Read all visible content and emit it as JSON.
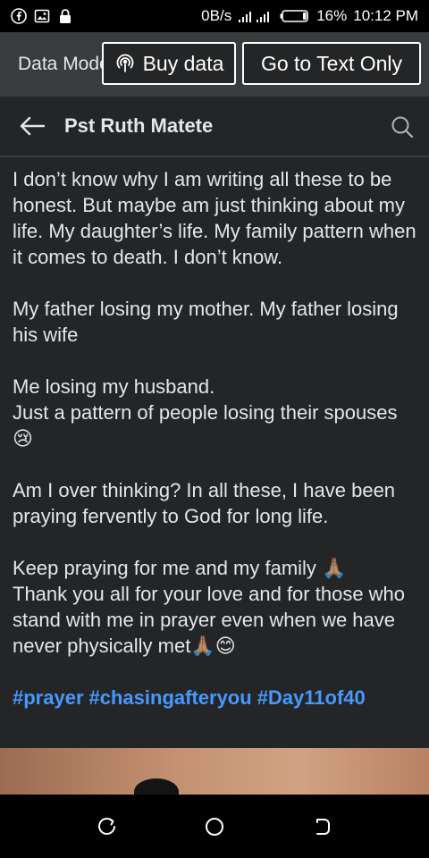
{
  "status_bar": {
    "net_speed": "0B/s",
    "battery": "16%",
    "time": "10:12 PM",
    "icons": [
      "facebook-icon",
      "image-icon",
      "lock-icon",
      "signal-icon",
      "battery-icon"
    ]
  },
  "data_bar": {
    "mode_label": "Data Mode",
    "buy_label": "Buy data",
    "text_only_label": "Go to Text Only"
  },
  "header": {
    "title": "Pst Ruth Matete"
  },
  "post": {
    "paragraphs": [
      "I don’t know why I am writing all these to be honest. But maybe am just thinking about my life. My daughter’s life. My family pattern when it comes to death. I don’t know.",
      "My father losing my mother. My father losing his wife",
      "Me losing my husband.\nJust a pattern of people losing their spouses 😢",
      "Am I over thinking? In all these, I have been praying fervently to God for long life.",
      "Keep praying for me and my family 🙏🏽\nThank you all for your love and for those who stand with me in prayer even when we have never physically met🙏🏽😊"
    ],
    "hashtags": [
      "#prayer",
      "#chasingafteryou",
      "#Day11of40"
    ]
  },
  "colors": {
    "background": "#242526",
    "hashtag": "#4599ff",
    "data_bar": "#3a3b3c"
  }
}
